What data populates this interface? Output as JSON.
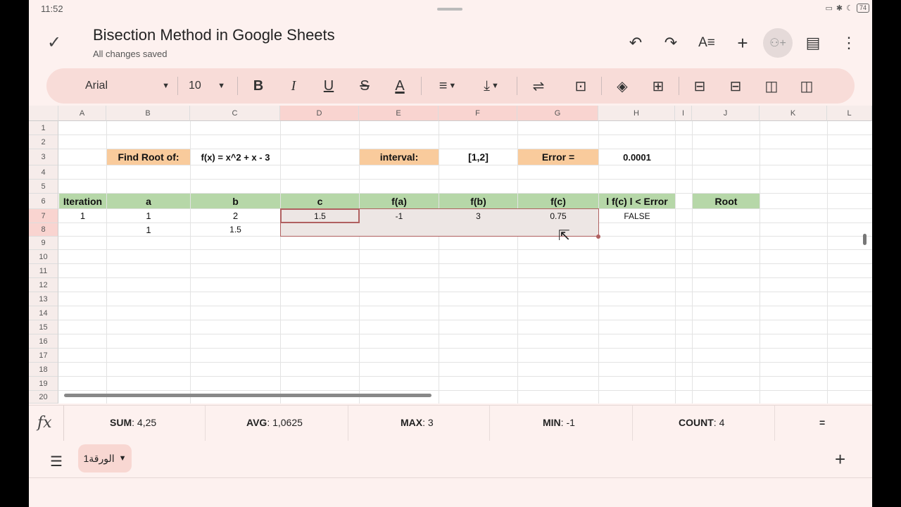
{
  "status": {
    "time": "11:52",
    "battery": "74"
  },
  "header": {
    "title": "Bisection Method in Google Sheets",
    "subtitle": "All changes saved",
    "icons": [
      "check-icon",
      "undo-icon",
      "redo-icon",
      "text-format-icon",
      "add-icon",
      "share-icon",
      "comment-icon",
      "more-icon"
    ]
  },
  "toolbar": {
    "font": "Arial",
    "font_size": "10",
    "bold_glyph": "B",
    "italic_glyph": "I",
    "underline_glyph": "U",
    "strike_glyph": "S",
    "text_color_glyph": "A"
  },
  "grid": {
    "columns": [
      "A",
      "B",
      "C",
      "D",
      "E",
      "F",
      "G",
      "H",
      "I",
      "J",
      "K",
      "L"
    ],
    "rows": [
      "1",
      "2",
      "3",
      "4",
      "5",
      "6",
      "7",
      "8",
      "9",
      "10",
      "11",
      "12",
      "13",
      "14",
      "15",
      "16",
      "17",
      "18",
      "19",
      "20"
    ],
    "cells": {
      "find_root_label": "Find Root of:",
      "function": "f(x) = x^2 + x - 3",
      "interval_label": "interval:",
      "interval_value": "[1,2]",
      "error_label": "Error =",
      "error_value": "0.0001",
      "headers": [
        "Iteration",
        "a",
        "b",
        "c",
        "f(a)",
        "f(b)",
        "f(c)",
        "l f(c) l < Error",
        "Root"
      ],
      "row7": [
        "1",
        "1",
        "2",
        "1.5",
        "-1",
        "3",
        "0.75",
        "FALSE"
      ],
      "row8": [
        "1",
        "1.5"
      ]
    },
    "colors": {
      "orange": "#f9cb9c",
      "green": "#b6d7a8"
    }
  },
  "stats": {
    "sum_label": "SUM",
    "sum_value": "4,25",
    "avg_label": "AVG",
    "avg_value": "1,0625",
    "max_label": "MAX",
    "max_value": "3",
    "min_label": "MIN",
    "min_value": "-1",
    "count_label": "COUNT",
    "count_value": "4",
    "equals": "="
  },
  "sheets": {
    "active": "الورقة1"
  }
}
